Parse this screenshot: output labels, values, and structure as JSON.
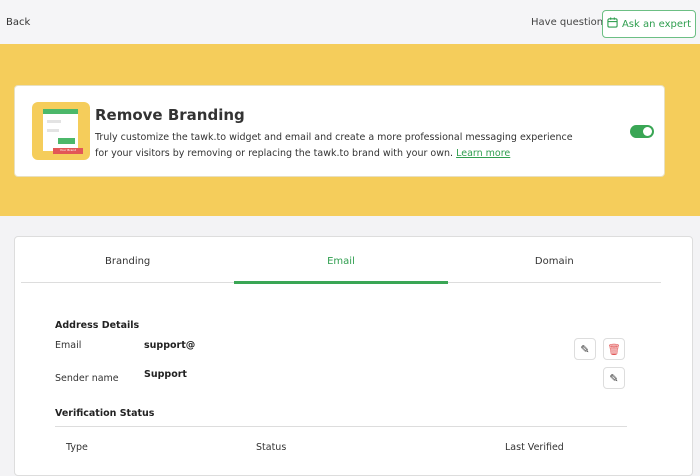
{
  "header": {
    "back_label": "Back",
    "questions_label": "Have questions?",
    "ask_expert_label": "Ask an expert"
  },
  "promo": {
    "title": "Remove Branding",
    "description": "Truly customize the tawk.to widget and email and create a more professional messaging experience for your visitors by removing or replacing the tawk.to brand with your own.",
    "learn_more": "Learn more",
    "thumb_text": "Your Brand",
    "toggle_on": true
  },
  "tabs": [
    {
      "label": "Branding"
    },
    {
      "label": "Email",
      "active": true
    },
    {
      "label": "Domain"
    }
  ],
  "address": {
    "heading": "Address Details",
    "email_label": "Email",
    "email_value": "support@",
    "sender_label": "Sender name",
    "sender_value": "Support"
  },
  "verification": {
    "heading": "Verification Status",
    "columns": [
      "Type",
      "Status",
      "Last Verified"
    ]
  },
  "colors": {
    "accent": "#3aa655",
    "band": "#f5cd5b",
    "danger": "#e25757"
  }
}
